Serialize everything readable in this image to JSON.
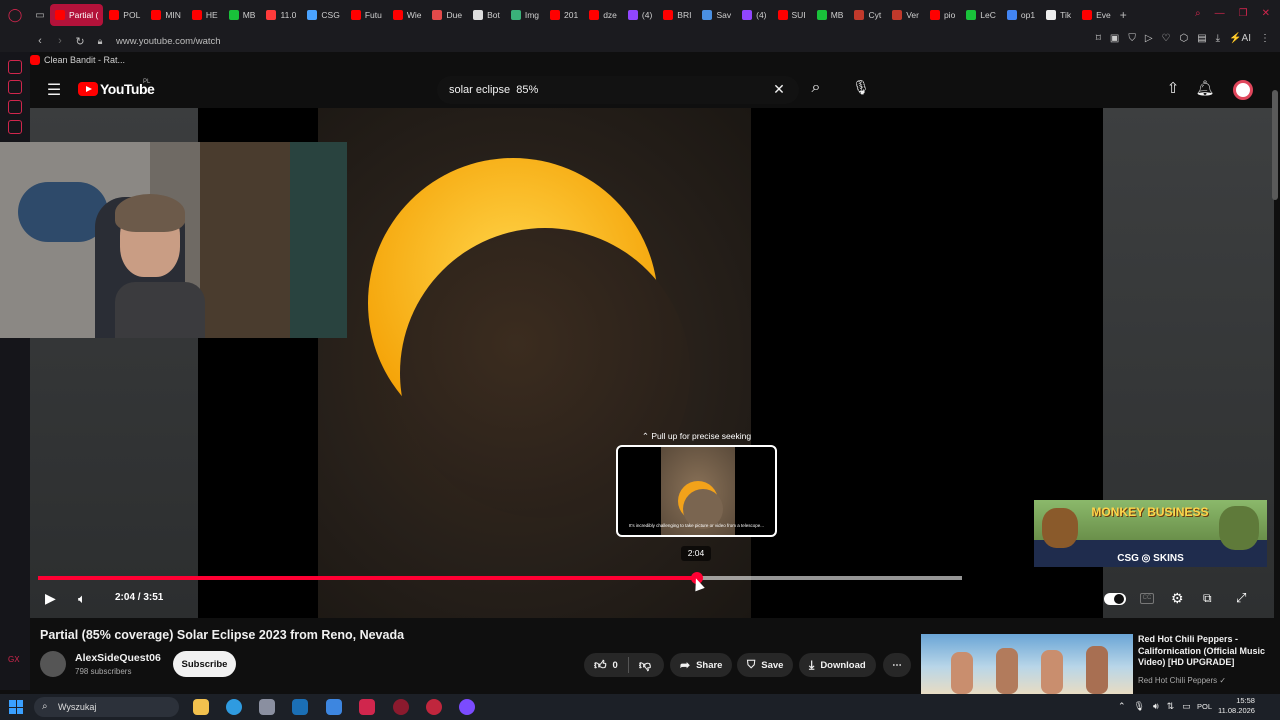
{
  "browser": {
    "tabs": [
      {
        "label": "Partial (",
        "color": "#ff0000",
        "active": true
      },
      {
        "label": "POL",
        "color": "#ff0000"
      },
      {
        "label": "MIN",
        "color": "#ff0000"
      },
      {
        "label": "HE",
        "color": "#ff0000"
      },
      {
        "label": "MB",
        "color": "#19c23a"
      },
      {
        "label": "11.0",
        "color": "#ff3b3b"
      },
      {
        "label": "CSG",
        "color": "#4aa3ff"
      },
      {
        "label": "Futu",
        "color": "#ff0000"
      },
      {
        "label": "Wie",
        "color": "#ff0000"
      },
      {
        "label": "Due",
        "color": "#e34a4a"
      },
      {
        "label": "Bot",
        "color": "#dddddd"
      },
      {
        "label": "Img",
        "color": "#3ab27a"
      },
      {
        "label": "201",
        "color": "#ff0000"
      },
      {
        "label": "dze",
        "color": "#ff0000"
      },
      {
        "label": "(4)",
        "color": "#9146ff"
      },
      {
        "label": "BRI",
        "color": "#ff0000"
      },
      {
        "label": "Sav",
        "color": "#4a90e2"
      },
      {
        "label": "(4)",
        "color": "#9146ff"
      },
      {
        "label": "SUI",
        "color": "#ff0000"
      },
      {
        "label": "MB",
        "color": "#19c23a"
      },
      {
        "label": "Cyt",
        "color": "#c0392b"
      },
      {
        "label": "Ver",
        "color": "#c0392b"
      },
      {
        "label": "pio",
        "color": "#ff0000"
      },
      {
        "label": "LeC",
        "color": "#19c23a"
      },
      {
        "label": "op1",
        "color": "#4285f4"
      },
      {
        "label": "Tik",
        "color": "#eeeeee"
      },
      {
        "label": "Eve",
        "color": "#ff0000"
      }
    ],
    "url": "www.youtube.com/watch",
    "bookmark": "Clean Bandit - Rat..."
  },
  "masthead": {
    "logo_text": "YouTube",
    "region": "PL",
    "search_value": "solar eclipse  85%"
  },
  "player": {
    "seek_hint": "⌃ Pull up for precise seeking",
    "preview_caption": "It's incredibly challenging to take picture or video from a telescope...",
    "preview_time": "2:04",
    "time_display": "2:04 / 3:51",
    "progress_fraction": 0.713,
    "buffered_fraction": 1.0,
    "accent": "#ff0033"
  },
  "ad": {
    "title": "MONKEY BUSINESS",
    "brand": "CSG ◎ SKINS"
  },
  "video": {
    "title": "Partial (85% coverage) Solar Eclipse 2023 from Reno, Nevada",
    "channel": "AlexSideQuest06",
    "subscribers": "798 subscribers",
    "subscribe_label": "Subscribe",
    "like_count": "0",
    "share_label": "Share",
    "save_label": "Save",
    "download_label": "Download"
  },
  "recommendation": {
    "title": "Red Hot Chili Peppers - Californication (Official Music Video) [HD UPGRADE]",
    "channel": "Red Hot Chili Peppers ✓"
  },
  "taskbar": {
    "search_placeholder": "Wyszukaj",
    "lang": "POL",
    "time": "15:58",
    "date": "11.08.2026"
  }
}
